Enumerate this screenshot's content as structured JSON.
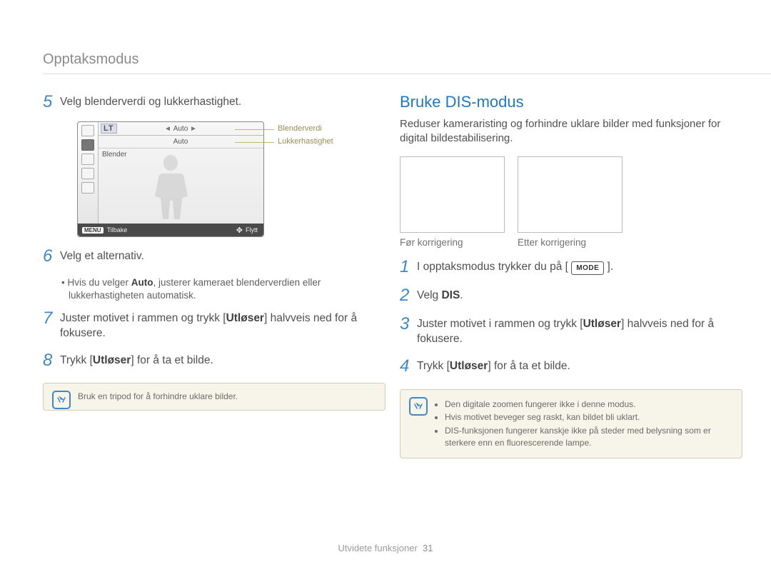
{
  "header": {
    "title": "Opptaksmodus"
  },
  "left": {
    "step5": {
      "num": "5",
      "text": "Velg blenderverdi og lukkerhastighet."
    },
    "lcd": {
      "lt": "LT",
      "auto1": "Auto",
      "auto2": "Auto",
      "blender": "Blender",
      "menu": "MENU",
      "tilbake": "Tilbake",
      "flytt": "Flytt",
      "label_blender": "Blenderverdi",
      "label_lukker": "Lukkerhastighet"
    },
    "step6": {
      "num": "6",
      "text": "Velg et alternativ.",
      "bullet_pre": "Hvis du velger ",
      "bullet_bold": "Auto",
      "bullet_post": ", justerer kameraet blenderverdien eller lukkerhastigheten automatisk."
    },
    "step7": {
      "num": "7",
      "pre": "Juster motivet i rammen og trykk [",
      "bold": "Utløser",
      "post": "] halvveis ned for å fokusere."
    },
    "step8": {
      "num": "8",
      "pre": "Trykk [",
      "bold": "Utløser",
      "post": "] for å ta et bilde."
    },
    "note": {
      "text": "Bruk en tripod for å forhindre uklare bilder."
    }
  },
  "right": {
    "title": "Bruke DIS-modus",
    "desc": "Reduser kameraristing og forhindre uklare bilder med funksjoner for digital bildestabilisering.",
    "sample_before": "Før korrigering",
    "sample_after": "Etter korrigering",
    "step1": {
      "num": "1",
      "pre": "I opptaksmodus trykker du på [ ",
      "mode": "MODE",
      "post": " ]."
    },
    "step2": {
      "num": "2",
      "pre": "Velg ",
      "bold": "DIS",
      "post": "."
    },
    "step3": {
      "num": "3",
      "pre": "Juster motivet i rammen og trykk [",
      "bold": "Utløser",
      "post": "] halvveis ned for å fokusere."
    },
    "step4": {
      "num": "4",
      "pre": "Trykk [",
      "bold": "Utløser",
      "post": "] for å ta et bilde."
    },
    "note": {
      "items": [
        "Den digitale zoomen fungerer ikke i denne modus.",
        "Hvis motivet beveger seg raskt, kan bildet bli uklart.",
        "DIS-funksjonen fungerer kanskje ikke på steder med belysning som er sterkere enn en fluorescerende lampe."
      ]
    }
  },
  "footer": {
    "section": "Utvidete funksjoner",
    "page": "31"
  }
}
